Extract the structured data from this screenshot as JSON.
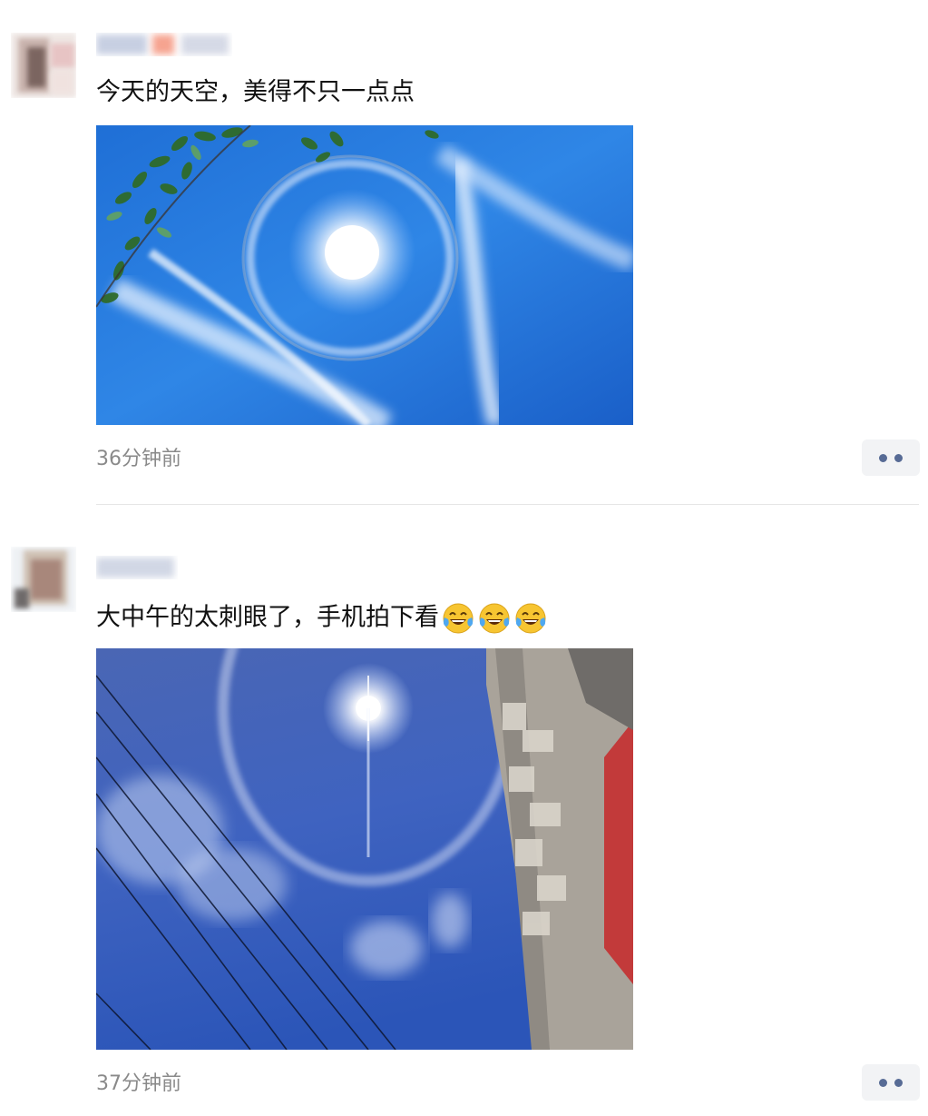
{
  "feed": {
    "posts": [
      {
        "text": "今天的天空，美得不只一点点",
        "time": "36分钟前",
        "photo_icon": "sun-halo-blue-sky-with-leaves"
      },
      {
        "text": "大中午的太刺眼了，手机拍下看",
        "emoji": [
          "😂",
          "😂",
          "😂"
        ],
        "emoji_icon": "tears-of-joy-emoji",
        "time": "37分钟前",
        "photo_icon": "sun-halo-over-building-and-wires"
      }
    ]
  },
  "colors": {
    "link_blue": "#576b95",
    "timestamp_gray": "#8a8a8a",
    "more_button_bg": "#f2f3f5"
  }
}
